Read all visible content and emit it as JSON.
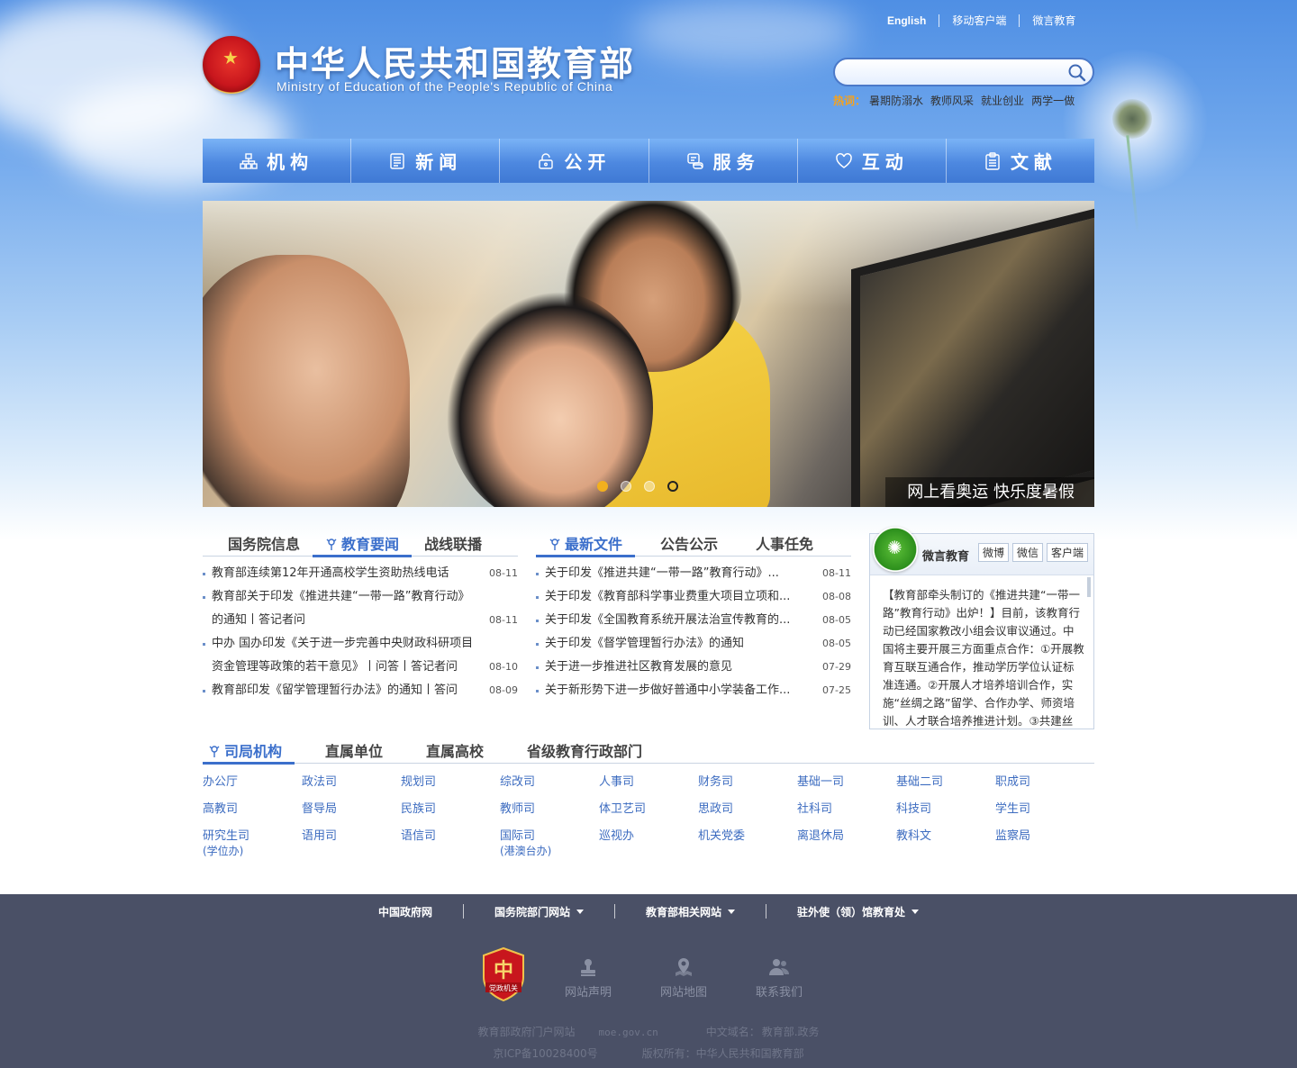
{
  "header": {
    "title_cn": "中华人民共和国教育部",
    "title_en": "Ministry of Education of the People's Republic of China",
    "top_links": [
      "English",
      "移动客户端",
      "微言教育"
    ],
    "search": {
      "placeholder": ""
    },
    "hot": {
      "label": "热词：",
      "items": [
        "暑期防溺水",
        "教师风采",
        "就业创业",
        "两学一做"
      ]
    }
  },
  "nav": {
    "items": [
      {
        "label": "机构",
        "icon": "org-icon"
      },
      {
        "label": "新闻",
        "icon": "news-icon"
      },
      {
        "label": "公开",
        "icon": "lock-icon"
      },
      {
        "label": "服务",
        "icon": "service-icon"
      },
      {
        "label": "互动",
        "icon": "heart-icon"
      },
      {
        "label": "文献",
        "icon": "document-icon"
      }
    ]
  },
  "banner": {
    "caption": "网上看奥运 快乐度暑假"
  },
  "news_left": {
    "tabs": [
      "国务院信息",
      "教育要闻",
      "战线联播"
    ],
    "active": 1,
    "items": [
      {
        "title": "教育部连续第12年开通高校学生资助热线电话",
        "date": "08-11"
      },
      {
        "title": "教育部关于印发《推进共建“一带一路”教育行动》",
        "date": ""
      },
      {
        "title": "的通知丨答记者问",
        "date": "08-11"
      },
      {
        "title": "中办 国办印发《关于进一步完善中央财政科研项目",
        "date": ""
      },
      {
        "title": "资金管理等政策的若干意见》丨问答丨答记者问",
        "date": "08-10"
      },
      {
        "title": "教育部印发《留学管理暂行办法》的通知丨答问",
        "date": "08-09"
      }
    ]
  },
  "news_right": {
    "tabs": [
      "最新文件",
      "公告公示",
      "人事任免"
    ],
    "active": 0,
    "items": [
      {
        "title": "关于印发《推进共建“一带一路”教育行动》...",
        "date": "08-11"
      },
      {
        "title": "关于印发《教育部科学事业费重大项目立项和...",
        "date": "08-08"
      },
      {
        "title": "关于印发《全国教育系统开展法治宣传教育的...",
        "date": "08-05"
      },
      {
        "title": "关于印发《督学管理暂行办法》的通知",
        "date": "08-05"
      },
      {
        "title": "关于进一步推进社区教育发展的意见",
        "date": "07-29"
      },
      {
        "title": "关于新形势下进一步做好普通中小学装备工作...",
        "date": "07-25"
      }
    ]
  },
  "weibo": {
    "name": "微言教育",
    "buttons": [
      "微博",
      "微信",
      "客户端"
    ],
    "text": "【教育部牵头制订的《推进共建“一带一路”教育行动》出炉！】目前，该教育行动已经国家教改小组会议审议通过。中国将主要开展三方面重点合作：①开展教育互联互通合作，推动学历学位认证标准连通。②开展人才培养培训合作，实施“丝绸之路”留学、合作办学、师资培训、人才联合培养推进计划。③共建丝"
  },
  "departments": {
    "tabs": [
      "司局机构",
      "直属单位",
      "直属高校",
      "省级教育行政部门"
    ],
    "active": 0,
    "rows": [
      [
        {
          "name": "办公厅"
        },
        {
          "name": "政法司"
        },
        {
          "name": "规划司"
        },
        {
          "name": "综改司"
        },
        {
          "name": "人事司"
        },
        {
          "name": "财务司"
        },
        {
          "name": "基础一司"
        },
        {
          "name": "基础二司"
        },
        {
          "name": "职成司"
        }
      ],
      [
        {
          "name": "高教司"
        },
        {
          "name": "督导局"
        },
        {
          "name": "民族司"
        },
        {
          "name": "教师司"
        },
        {
          "name": "体卫艺司"
        },
        {
          "name": "思政司"
        },
        {
          "name": "社科司"
        },
        {
          "name": "科技司"
        },
        {
          "name": "学生司"
        }
      ],
      [
        {
          "name": "研究生司",
          "sub": "(学位办)"
        },
        {
          "name": "语用司"
        },
        {
          "name": "语信司"
        },
        {
          "name": "国际司",
          "sub": "(港澳台办)"
        },
        {
          "name": "巡视办"
        },
        {
          "name": "机关党委"
        },
        {
          "name": "离退休局"
        },
        {
          "name": "教科文"
        },
        {
          "name": "监察局"
        }
      ]
    ]
  },
  "footer": {
    "links": [
      "中国政府网",
      "国务院部门网站",
      "教育部相关网站",
      "驻外使（领）馆教育处"
    ],
    "badge": "党政机关",
    "icons": [
      {
        "label": "网站声明",
        "icon": "stamp-icon"
      },
      {
        "label": "网站地图",
        "icon": "map-pin-icon"
      },
      {
        "label": "联系我们",
        "icon": "contacts-icon"
      }
    ],
    "line1": [
      "教育部政府门户网站",
      "moe.gov.cn",
      "中文域名：",
      "教育部.政务"
    ],
    "line2": [
      "京ICP备10028400号",
      "版权所有：中华人民共和国教育部"
    ]
  },
  "colors": {
    "accent": "#3b6fcb",
    "nav": "#4d88e0",
    "footer": "#4a5066",
    "hot": "#f7a21b"
  }
}
